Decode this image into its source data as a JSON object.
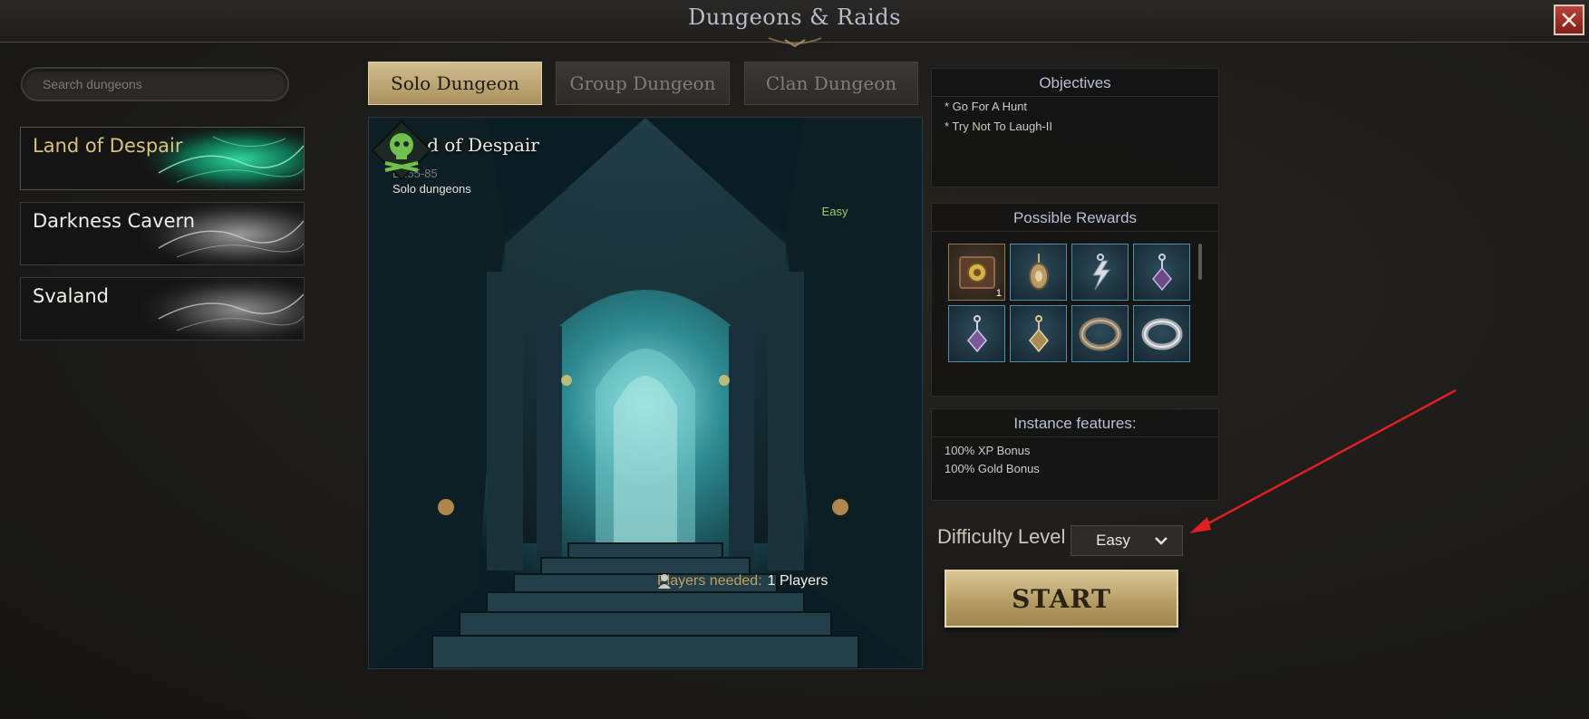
{
  "window": {
    "title": "Dungeons & Raids"
  },
  "search": {
    "placeholder": "Search dungeons"
  },
  "dungeons": [
    {
      "label": "Land of Despair",
      "active": true
    },
    {
      "label": "Darkness Cavern",
      "active": false
    },
    {
      "label": "Svaland",
      "active": false
    }
  ],
  "tabs": [
    {
      "label": "Solo Dungeon",
      "active": true
    },
    {
      "label": "Group Dungeon",
      "active": false
    },
    {
      "label": "Clan Dungeon",
      "active": false
    }
  ],
  "detail": {
    "title": "Land of Despair",
    "level": "Lv.55-85",
    "mode": "Solo dungeons",
    "difficulty_badge": "Easy",
    "players_label": "Players needed:",
    "players_value": "1 Players"
  },
  "objectives": {
    "title": "Objectives",
    "items": [
      "* Go For A Hunt",
      "* Try Not To Laugh-II"
    ]
  },
  "rewards": {
    "title": "Possible Rewards",
    "items": [
      {
        "icon": "spellbook-icon",
        "count": "1"
      },
      {
        "icon": "amulet-icon",
        "count": ""
      },
      {
        "icon": "lightning-earring-icon",
        "count": ""
      },
      {
        "icon": "purple-earring-icon",
        "count": ""
      },
      {
        "icon": "purple-earring-icon",
        "count": ""
      },
      {
        "icon": "gold-earring-icon",
        "count": ""
      },
      {
        "icon": "engraved-ring-icon",
        "count": ""
      },
      {
        "icon": "silver-ring-icon",
        "count": ""
      }
    ]
  },
  "features": {
    "title": "Instance features:",
    "items": [
      "100% XP Bonus",
      "100% Gold Bonus"
    ]
  },
  "difficulty": {
    "label": "Difficulty Level",
    "selected": "Easy"
  },
  "start_button": {
    "label": "START"
  },
  "colors": {
    "accent_gold": "#c9b27f",
    "active_text": "#d9c37a",
    "easy_green": "#8cd26a",
    "annotation_red": "#e02020"
  }
}
